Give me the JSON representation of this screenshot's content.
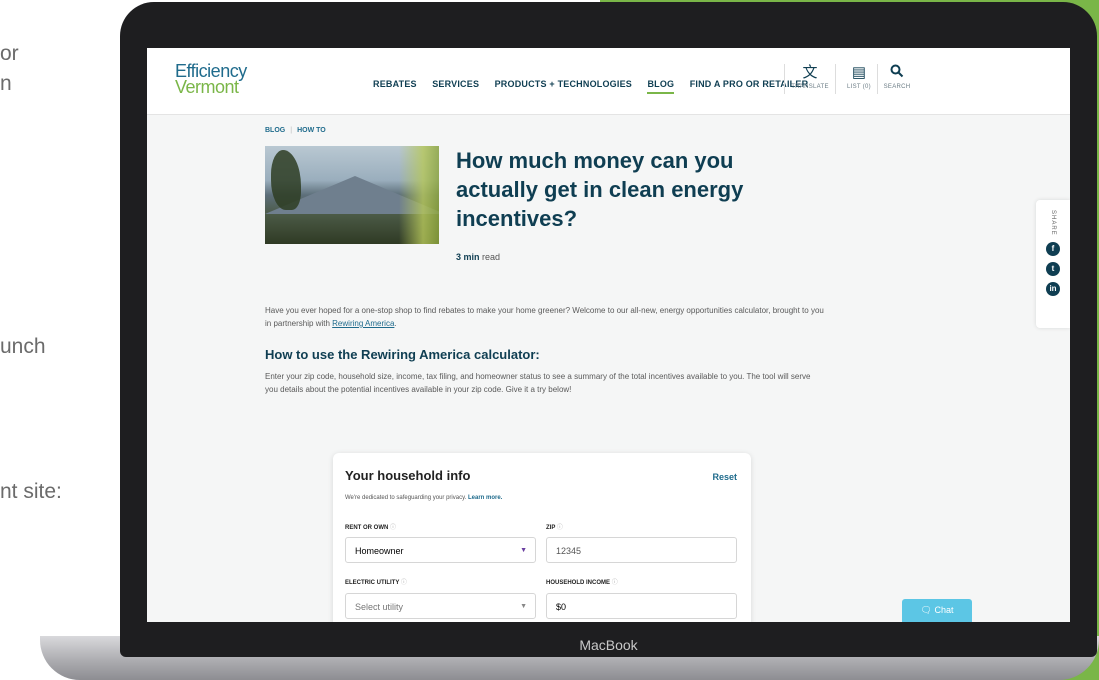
{
  "slide": {
    "fragments": [
      "or",
      "n",
      "unch",
      "nt site:"
    ],
    "colors": {
      "panel": "#7ab648",
      "text": "#6b6b6b"
    }
  },
  "device": {
    "brand": "MacBook"
  },
  "site": {
    "logo": {
      "line1": "Efficiency",
      "line2": "Vermont"
    },
    "nav": [
      {
        "label": "REBATES",
        "active": false
      },
      {
        "label": "SERVICES",
        "active": false
      },
      {
        "label": "PRODUCTS + TECHNOLOGIES",
        "active": false
      },
      {
        "label": "BLOG",
        "active": true
      },
      {
        "label": "FIND A PRO OR RETAILER",
        "active": false
      }
    ],
    "utilities": [
      {
        "icon": "translate-icon",
        "label": "TRANSLATE"
      },
      {
        "icon": "list-icon",
        "label": "LIST (0)"
      },
      {
        "icon": "search-icon",
        "label": "SEARCH"
      }
    ],
    "colors": {
      "navy": "#0f3e52",
      "link": "#1f6b8c",
      "accent": "#7ab648",
      "chat": "#5cc6e5"
    }
  },
  "article": {
    "breadcrumb": [
      "BLOG",
      "HOW TO"
    ],
    "title": "How much money can you actually get in clean energy incentives?",
    "read_time_value": "3 min",
    "read_time_unit": "read",
    "intro_text": "Have you ever hoped for a one-stop shop to find rebates to make your home greener? Welcome to our all-new, energy opportunities calculator, brought to you in partnership with ",
    "intro_link": "Rewiring America",
    "intro_end": ".",
    "section_heading": "How to use the Rewiring America calculator:",
    "section_text": "Enter your zip code, household size, income, tax filing, and homeowner status to see a summary of the total incentives available to you. The tool will serve you details about the potential incentives available in your zip code. Give it a try below!"
  },
  "share": {
    "label": "SHARE",
    "networks": [
      {
        "icon": "facebook-icon",
        "glyph": "f"
      },
      {
        "icon": "twitter-icon",
        "glyph": "t"
      },
      {
        "icon": "linkedin-icon",
        "glyph": "in"
      }
    ]
  },
  "calculator": {
    "title": "Your household info",
    "reset": "Reset",
    "privacy_text": "We're dedicated to safeguarding your privacy.",
    "privacy_link": "Learn more.",
    "fields": {
      "rent_or_own": {
        "label": "RENT OR OWN",
        "value": "Homeowner"
      },
      "zip": {
        "label": "ZIP",
        "value": "12345"
      },
      "electric_utility": {
        "label": "ELECTRIC UTILITY",
        "value": "Select utility"
      },
      "household_income": {
        "label": "HOUSEHOLD INCOME",
        "value": "$0"
      }
    }
  },
  "chat": {
    "label": "Chat"
  }
}
